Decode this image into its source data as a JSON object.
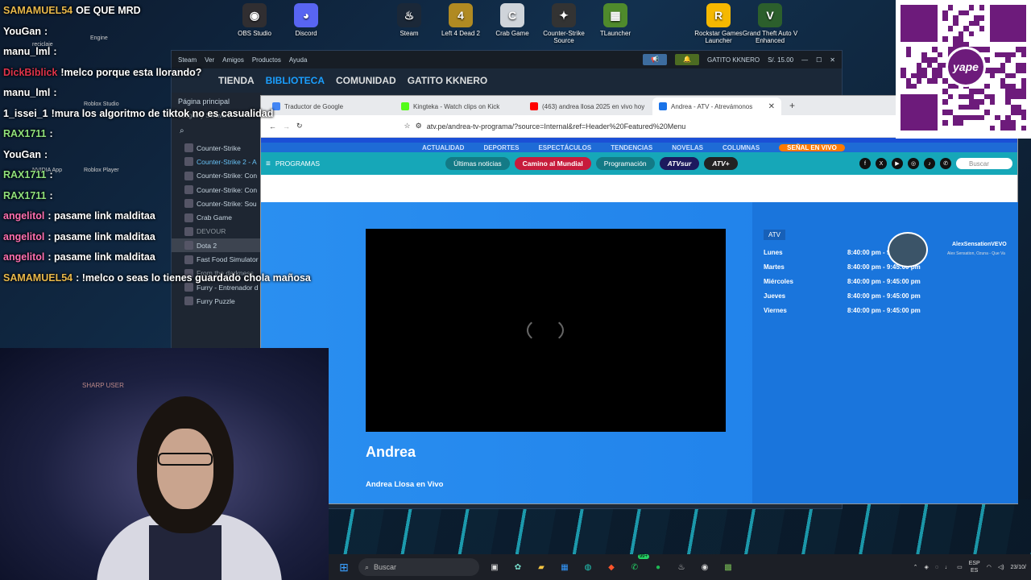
{
  "chat": [
    {
      "name": "SAMAMUEL54",
      "msg": "OE QUE MRD",
      "color": "#e8b84a"
    },
    {
      "name": "YouGan",
      "msg": ":",
      "color": "#ffffff"
    },
    {
      "name": "manu_lml",
      "msg": ":",
      "color": "#ffffff"
    },
    {
      "name": "DickBiblick",
      "msg": "!melco porque esta llorando?",
      "color": "#e0334a"
    },
    {
      "name": "manu_lml",
      "msg": ":",
      "color": "#ffffff"
    },
    {
      "name": "1_issei_1",
      "msg": "!mura los algoritmo de tiktok no es casualidad",
      "color": "#ffffff"
    },
    {
      "name": "RAX1711",
      "msg": ":",
      "color": "#8fe07a"
    },
    {
      "name": "YouGan",
      "msg": ":",
      "color": "#ffffff"
    },
    {
      "name": "RAX1711",
      "msg": ":",
      "color": "#8fe07a"
    },
    {
      "name": "RAX1711",
      "msg": ":",
      "color": "#8fe07a"
    },
    {
      "name": "angelitol",
      "msg": ": pasame link malditaa",
      "color": "#ff6fb0"
    },
    {
      "name": "angelitol",
      "msg": ": pasame link malditaa",
      "color": "#ff6fb0"
    },
    {
      "name": "angelitol",
      "msg": ": pasame link malditaa",
      "color": "#ff6fb0"
    },
    {
      "name": "SAMAMUEL54",
      "msg": ": !melco o seas lo tienes guardado chola mañosa",
      "color": "#e8b84a"
    }
  ],
  "desktop_icons": [
    {
      "label": "OBS Studio",
      "icon": "obs-icon",
      "color": "#302e31",
      "glyph": "◉"
    },
    {
      "label": "Discord",
      "icon": "discord-icon",
      "color": "#5865f2",
      "glyph": "◕"
    },
    {
      "label": "Steam",
      "icon": "steam-icon",
      "color": "#1b2838",
      "glyph": "♨"
    },
    {
      "label": "Left 4 Dead 2",
      "icon": "l4d2-icon",
      "color": "#b08a22",
      "glyph": "4"
    },
    {
      "label": "Crab Game",
      "icon": "crabgame-icon",
      "color": "#cfd4da",
      "glyph": "C"
    },
    {
      "label": "Counter-Strike Source",
      "icon": "css-icon",
      "color": "#333333",
      "glyph": "✦"
    },
    {
      "label": "TLauncher",
      "icon": "tlauncher-icon",
      "color": "#4f8a2c",
      "glyph": "▦"
    },
    {
      "label": "Rockstar Games Launcher",
      "icon": "rockstar-icon",
      "color": "#f5b800",
      "glyph": "R"
    },
    {
      "label": "Grand Theft Auto V Enhanced",
      "icon": "gta-icon",
      "color": "#2c5f2c",
      "glyph": "V"
    }
  ],
  "small_desktop_labels": [
    "reciclaje",
    "NVIDIA App",
    "Roblox Player",
    "Roblox Studio",
    "Engine"
  ],
  "steam": {
    "menu": [
      "Steam",
      "Ver",
      "Amigos",
      "Productos",
      "Ayuda"
    ],
    "user": "GATITO KKNERO",
    "balance": "S/. 15.00",
    "nav": [
      "TIENDA",
      "BIBLIOTECA",
      "COMUNIDAD",
      "GATITO KKNERO"
    ],
    "home": "Página principal",
    "filter": "Juegos y Software",
    "games": [
      "Counter-Strike",
      "Counter-Strike 2 - A",
      "Counter-Strike: Con",
      "Counter-Strike: Con",
      "Counter-Strike: Sou",
      "Crab Game",
      "DEVOUR",
      "Dota 2",
      "Fast Food Simulator",
      "From the darkness",
      "Furry - Entrenador d",
      "Furry Puzzle"
    ]
  },
  "browser": {
    "tabs": [
      {
        "title": "Traductor de Google",
        "color": "#4285f4"
      },
      {
        "title": "Kingteka - Watch clips on Kick",
        "color": "#53fc18"
      },
      {
        "title": "(463) andrea llosa 2025 en vivo hoy",
        "color": "#ff0000"
      },
      {
        "title": "Andrea - ATV - Atrevámonos",
        "color": "#1a73e8"
      }
    ],
    "url": "atv.pe/andrea-tv-programa/?source=Internal&ref=Header%20Featured%20Menu"
  },
  "site": {
    "topnav": [
      "ACTUALIDAD",
      "DEPORTES",
      "ESPECTÁCULOS",
      "TENDENCIAS",
      "NOVELAS",
      "COLUMNAS"
    ],
    "live_label": "SEÑAL EN VIVO",
    "programs_label": "PROGRAMAS",
    "pills": [
      "Últimas noticias",
      "Camino al Mundial",
      "Programación"
    ],
    "brand_pills": [
      "ATVsur",
      "ATV+"
    ],
    "search_placeholder": "Buscar",
    "show_title": "Andrea",
    "show_subtitle": "Andrea Llosa en Vivo",
    "channel": "ATV",
    "schedule": [
      {
        "day": "Lunes",
        "time": "8:40:00 pm - 9:45:00 pm"
      },
      {
        "day": "Martes",
        "time": "8:40:00 pm - 9:45:00 pm"
      },
      {
        "day": "Miércoles",
        "time": "8:40:00 pm - 9:45:00 pm"
      },
      {
        "day": "Jueves",
        "time": "8:40:00 pm - 9:45:00 pm"
      },
      {
        "day": "Viernes",
        "time": "8:40:00 pm - 9:45:00 pm"
      }
    ]
  },
  "music": {
    "artist": "AlexSensationVEVO",
    "song": "Alex Sensation, Ozuna - Que Va"
  },
  "webcam_label": "SHARP USER",
  "qr_logo": "yape",
  "taskbar": {
    "search": "Buscar",
    "badge": "99+",
    "lang": "ESP",
    "lang2": "ES",
    "date": "23/10/"
  }
}
